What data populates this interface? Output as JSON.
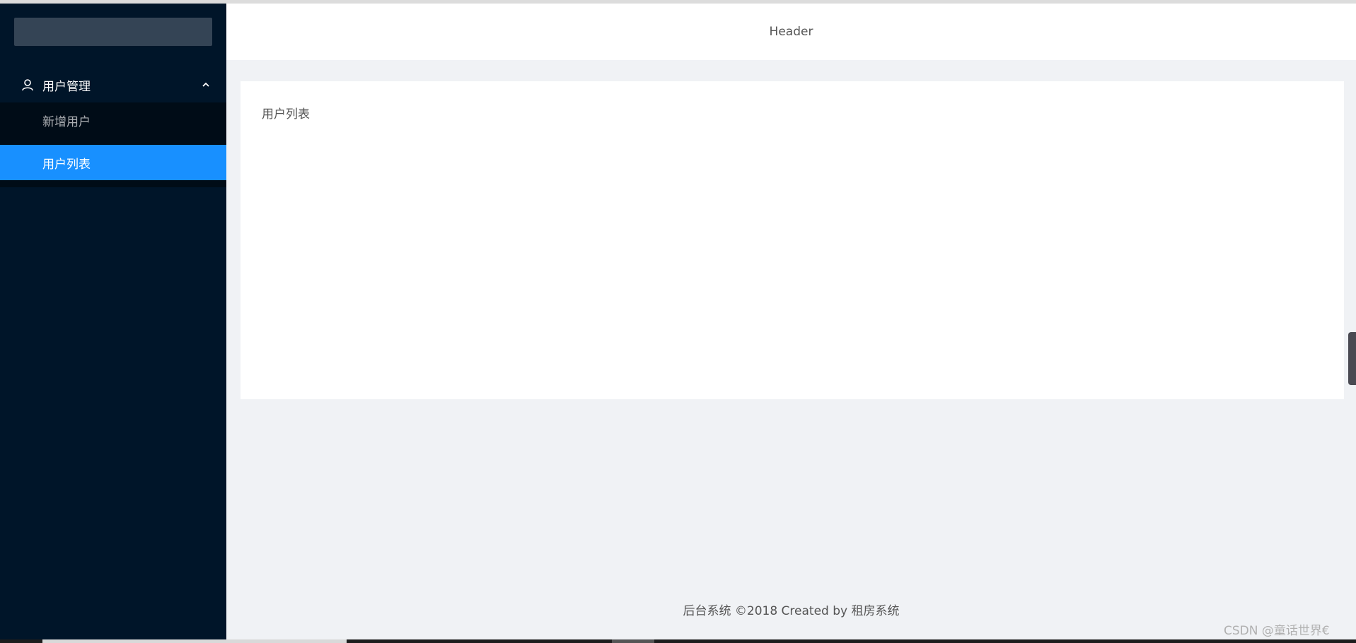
{
  "sidebar": {
    "submenu": {
      "title": "用户管理",
      "icon": "user-icon",
      "expanded_icon": "chevron-up-icon",
      "items": [
        {
          "label": "新增用户",
          "selected": false
        },
        {
          "label": "用户列表",
          "selected": true
        }
      ]
    }
  },
  "header": {
    "title": "Header"
  },
  "content": {
    "text": "用户列表"
  },
  "footer": {
    "text": "后台系统 ©2018 Created by 租房系统"
  },
  "watermark": {
    "text": "CSDN @童话世界€"
  },
  "colors": {
    "sider_bg": "#001529",
    "submenu_bg": "#000c17",
    "selected": "#1890ff",
    "layout_bg": "#f0f2f5"
  }
}
